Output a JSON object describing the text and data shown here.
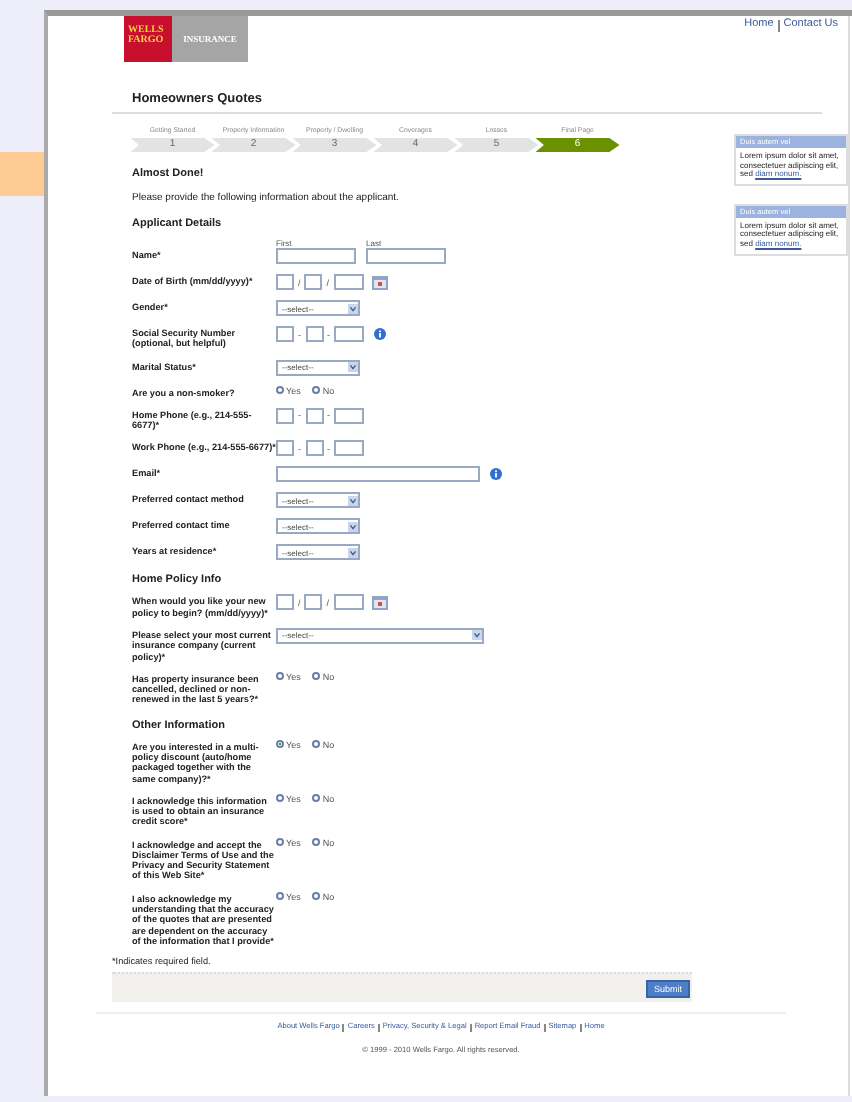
{
  "header": {
    "logo_top": "WELLS FARGO",
    "logo_side": "INSURANCE",
    "links": [
      "Home",
      "Contact Us"
    ]
  },
  "title": "Homeowners Quotes",
  "steps": [
    {
      "label": "Getting Started",
      "number": "1",
      "selected": false
    },
    {
      "label": "Property Information",
      "number": "2",
      "selected": false
    },
    {
      "label": "Property / Dwelling",
      "number": "3",
      "selected": false
    },
    {
      "label": "Coverages",
      "number": "4",
      "selected": false
    },
    {
      "label": "Losses",
      "number": "5",
      "selected": false
    },
    {
      "label": "Final Page",
      "number": "6",
      "selected": true
    }
  ],
  "heading": "Almost Done!",
  "intro": "Please provide the following information about the applicant.",
  "sections": [
    {
      "title": "Applicant Details",
      "fields": [
        {
          "kind": "name",
          "label": "Name*",
          "captions": [
            "First",
            "Last"
          ]
        },
        {
          "kind": "triple",
          "label": "Date of Birth (mm/dd/yyyy)*",
          "separator": "/",
          "calendar": true,
          "info": false
        },
        {
          "kind": "select",
          "label": "Gender*",
          "value": "--select--"
        },
        {
          "kind": "triple",
          "label": "Social Security Number (optional, but helpful)",
          "separator": "-",
          "calendar": false,
          "info": true
        },
        {
          "kind": "select",
          "label": "Marital Status*",
          "value": "--select--"
        },
        {
          "kind": "radio",
          "label": "Are you a non-smoker?",
          "options": [
            {
              "label": "Yes",
              "selected": false
            },
            {
              "label": "No",
              "selected": false
            }
          ]
        },
        {
          "kind": "triple",
          "label": "Home Phone (e.g., 214-555-6677)*",
          "separator": "-",
          "calendar": false,
          "info": false
        },
        {
          "kind": "triple",
          "label": "Work Phone (e.g., 214-555-6677)*",
          "separator": "-",
          "calendar": false,
          "info": false
        },
        {
          "kind": "text",
          "label": "Email*",
          "info": true
        },
        {
          "kind": "select",
          "label": "Preferred contact method",
          "value": "--select--"
        },
        {
          "kind": "select",
          "label": "Preferred contact time",
          "value": "--select--"
        },
        {
          "kind": "select",
          "label": "Years at residence*",
          "value": "--select--"
        }
      ]
    },
    {
      "title": "Home Policy Info",
      "fields": [
        {
          "kind": "triple",
          "label": "When would you like your new policy to begin? (mm/dd/yyyy)*",
          "separator": "/",
          "calendar": true,
          "info": false
        },
        {
          "kind": "longselect",
          "label": "Please select your most current insurance company (current policy)*",
          "value": "--select--"
        },
        {
          "kind": "radio",
          "label": "Has property insurance been cancelled, declined or non-renewed in the last 5 years?*",
          "options": [
            {
              "label": "Yes",
              "selected": false
            },
            {
              "label": "No",
              "selected": false
            }
          ]
        }
      ]
    },
    {
      "title": "Other Information",
      "fields": [
        {
          "kind": "radio",
          "label": "Are you interested in a multi-policy discount (auto/home packaged together with the same company)?*",
          "options": [
            {
              "label": "Yes",
              "selected": true
            },
            {
              "label": "No",
              "selected": false
            }
          ]
        },
        {
          "kind": "radio",
          "label": "I acknowledge this information is used to obtain an insurance credit score*",
          "options": [
            {
              "label": "Yes",
              "selected": false
            },
            {
              "label": "No",
              "selected": false
            }
          ]
        },
        {
          "kind": "radio",
          "label": "I acknowledge and accept the Disclaimer Terms of Use and the Privacy and Security Statement of this Web Site*",
          "options": [
            {
              "label": "Yes",
              "selected": false
            },
            {
              "label": "No",
              "selected": false
            }
          ]
        },
        {
          "kind": "radio",
          "label": "I also acknowledge my understanding that the accuracy of the quotes that are presented are dependent on the accuracy of the information that I provide*",
          "options": [
            {
              "label": "Yes",
              "selected": false
            },
            {
              "label": "No",
              "selected": false
            }
          ]
        }
      ]
    }
  ],
  "required_note": "*Indicates required field.",
  "submit": "Submit",
  "sidebar": [
    {
      "title": "Duis autem vel",
      "text": "Lorem ipsum dolor sit amet, consectetuer adipiscing elit, sed",
      "link": "diam nonum."
    },
    {
      "title": "Duis autem vel",
      "text": "Lorem ipsum dolor sit amet, consectetuer adipiscing elit, sed",
      "link": "diam nonum."
    }
  ],
  "footer": {
    "links": [
      "About Wells Fargo",
      "Careers",
      "Privacy, Security & Legal",
      "Report Email Fraud",
      "Sitemap",
      "Home"
    ],
    "copyright": "© 1999 - 2010 Wells Fargo. All rights reserved."
  }
}
